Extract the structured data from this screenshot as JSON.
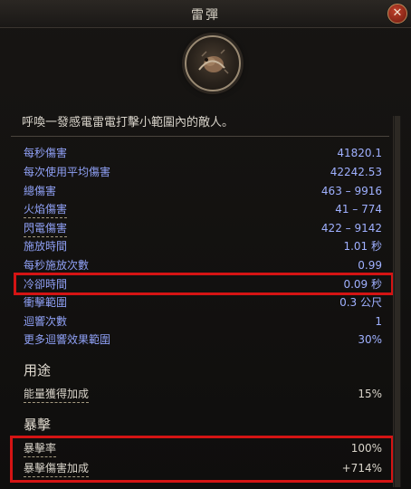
{
  "window": {
    "title": "雷彈",
    "close_glyph": "✕"
  },
  "skill": {
    "icon": "creature-icon"
  },
  "description": "呼喚一發感電雷電打擊小範圍內的敵人。",
  "stats": [
    {
      "label": "每秒傷害",
      "value": "41820.1"
    },
    {
      "label": "每次使用平均傷害",
      "value": "42242.53"
    },
    {
      "label": "總傷害",
      "value": "463 – 9916"
    },
    {
      "label": "火焰傷害",
      "value": "41 – 774"
    },
    {
      "label": "閃電傷害",
      "value": "422 – 9142"
    },
    {
      "label": "施放時間",
      "value": "1.01 秒"
    },
    {
      "label": "每秒施放次數",
      "value": "0.99"
    },
    {
      "label": "冷卻時間",
      "value": "0.09 秒"
    },
    {
      "label": "衝擊範圍",
      "value": "0.3 公尺"
    },
    {
      "label": "迴響次數",
      "value": "1"
    },
    {
      "label": "更多迴響效果範圍",
      "value": "30%"
    }
  ],
  "usage": {
    "heading": "用途",
    "rows": [
      {
        "label": "能量獲得加成",
        "value": "15%"
      }
    ]
  },
  "crit": {
    "heading": "暴擊",
    "rows": [
      {
        "label": "暴擊率",
        "value": "100%"
      },
      {
        "label": "暴擊傷害加成",
        "value": "+714%"
      }
    ]
  },
  "colors": {
    "stat_text": "#9fb0ff",
    "highlight": "#d41414"
  }
}
